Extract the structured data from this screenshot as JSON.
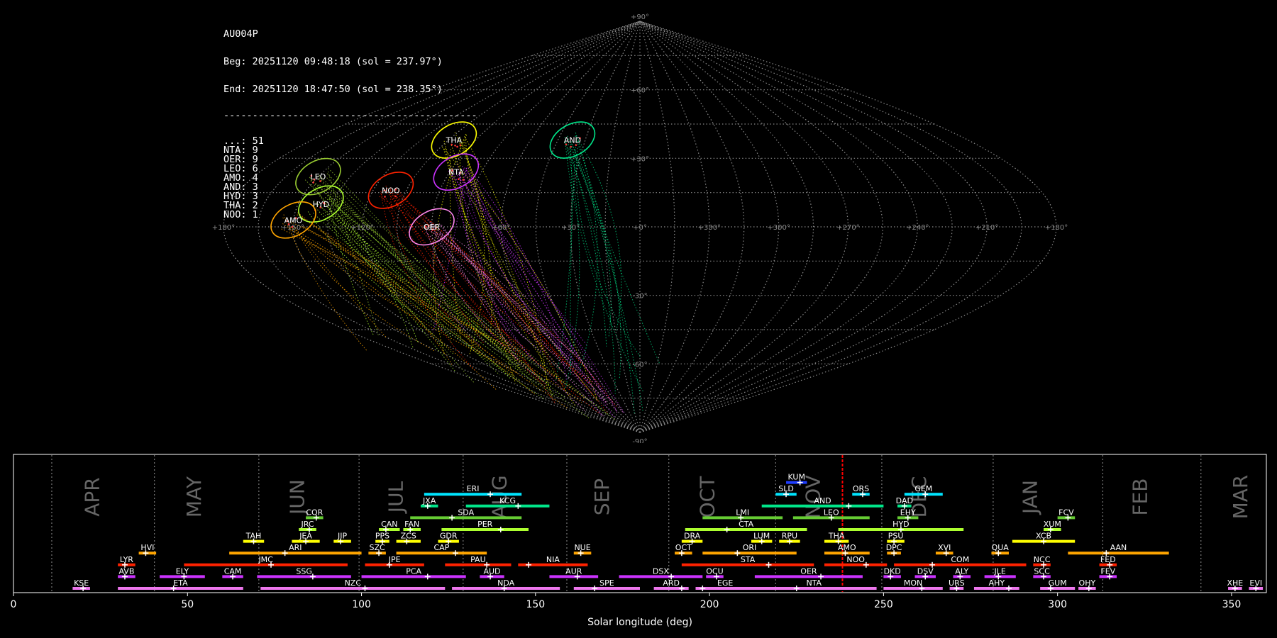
{
  "info": {
    "station": "AU004P",
    "begin": "Beg: 20251120 09:48:18 (sol = 237.97°)",
    "end": "End: 20251120 18:47:50 (sol = 238.35°)",
    "separator": "--------------------------------------------",
    "counts": [
      "...: 51",
      "NTA: 9",
      "OER: 9",
      "LEO: 6",
      "AMO: 4",
      "AND: 3",
      "HYD: 3",
      "THA: 2",
      "NOO: 1"
    ]
  },
  "colors": {
    "background": "#000000",
    "grid": "#888888",
    "current_sol_marker": "#ff0000",
    "timeline_frame": "#ffffff"
  },
  "chart_data": [
    {
      "type": "scatter",
      "projection": "sinusoidal",
      "lon_ticks": [
        "+180°",
        "+150°",
        "+120°",
        "+90°",
        "+60°",
        "+30°",
        "+0°",
        "+330°",
        "+300°",
        "+270°",
        "+240°",
        "+210°",
        "+180°"
      ],
      "lat_ticks": [
        "+90°",
        "+60°",
        "+30°",
        "-30°",
        "-60°",
        "-90°"
      ],
      "radiants": [
        {
          "name": "LEO",
          "lon": 150,
          "lat": 22,
          "color": "#9acd32"
        },
        {
          "name": "THA",
          "lon": 102,
          "lat": 38,
          "color": "#ffff00"
        },
        {
          "name": "AND",
          "lon": 37,
          "lat": 38,
          "color": "#00e68a"
        },
        {
          "name": "NTA",
          "lon": 87,
          "lat": 24,
          "color": "#cc33ff"
        },
        {
          "name": "NOO",
          "lon": 112,
          "lat": 16,
          "color": "#ff2200"
        },
        {
          "name": "HYD",
          "lon": 140,
          "lat": 10,
          "color": "#adff2f"
        },
        {
          "name": "AMO",
          "lon": 150,
          "lat": 3,
          "color": "#ffa500"
        },
        {
          "name": "OER",
          "lon": 90,
          "lat": 0,
          "color": "#ff88ee"
        }
      ]
    },
    {
      "type": "bar",
      "xlabel": "Solar longitude (deg)",
      "xlim": [
        0,
        360
      ],
      "x_ticks": [
        "0",
        "50",
        "100",
        "150",
        "200",
        "250",
        "300",
        "350"
      ],
      "current_sol": 238.2,
      "months": [
        {
          "name": "APR",
          "pos": 24.6
        },
        {
          "name": "MAY",
          "pos": 53.8
        },
        {
          "name": "JUN",
          "pos": 83.5
        },
        {
          "name": "JUL",
          "pos": 111.8
        },
        {
          "name": "AUG",
          "pos": 141.6
        },
        {
          "name": "SEP",
          "pos": 171.0
        },
        {
          "name": "OCT",
          "pos": 201.3
        },
        {
          "name": "NOV",
          "pos": 231.7
        },
        {
          "name": "DEC",
          "pos": 262.2
        },
        {
          "name": "JAN",
          "pos": 294.1
        },
        {
          "name": "FEB",
          "pos": 325.7
        },
        {
          "name": "MAR",
          "pos": 354.5
        }
      ],
      "month_dividers": [
        11.0,
        40.5,
        70.5,
        99.3,
        129.2,
        159.0,
        188.3,
        219.0,
        249.5,
        281.5,
        313.0,
        341.2
      ],
      "showers": [
        {
          "code": "KUM",
          "row": 10,
          "start": 222,
          "end": 228,
          "peak": 226,
          "color": "#1e3cff"
        },
        {
          "code": "ERI",
          "row": 9,
          "start": 118,
          "end": 146,
          "peak": 137,
          "color": "#00e5ff"
        },
        {
          "code": "SLD",
          "row": 9,
          "start": 219,
          "end": 225,
          "peak": 222,
          "color": "#00e5ff"
        },
        {
          "code": "ORS",
          "row": 9,
          "start": 241,
          "end": 246,
          "peak": 244,
          "color": "#00e5ff"
        },
        {
          "code": "GEM",
          "row": 9,
          "start": 256,
          "end": 267,
          "peak": 262,
          "color": "#00e5ff"
        },
        {
          "code": "JXA",
          "row": 8,
          "start": 117,
          "end": 122,
          "peak": 119,
          "color": "#00e68a"
        },
        {
          "code": "KCG",
          "row": 8,
          "start": 130,
          "end": 154,
          "peak": 145,
          "color": "#00e68a"
        },
        {
          "code": "AND",
          "row": 8,
          "start": 215,
          "end": 250,
          "peak": 240,
          "color": "#00e68a"
        },
        {
          "code": "DAD",
          "row": 8,
          "start": 254,
          "end": 258,
          "peak": 256,
          "color": "#00e68a"
        },
        {
          "code": "COR",
          "row": 7,
          "start": 84,
          "end": 89,
          "peak": 87,
          "color": "#66cc33"
        },
        {
          "code": "SDA",
          "row": 7,
          "start": 114,
          "end": 146,
          "peak": 126,
          "color": "#66cc33"
        },
        {
          "code": "LMI",
          "row": 7,
          "start": 198,
          "end": 221,
          "peak": 209,
          "color": "#66cc33"
        },
        {
          "code": "LEO",
          "row": 7,
          "start": 224,
          "end": 246,
          "peak": 235,
          "color": "#66cc33"
        },
        {
          "code": "EHY",
          "row": 7,
          "start": 254,
          "end": 260,
          "peak": 257,
          "color": "#66cc33"
        },
        {
          "code": "FCV",
          "row": 7,
          "start": 300,
          "end": 305,
          "peak": 303,
          "color": "#66cc33"
        },
        {
          "code": "JRC",
          "row": 6,
          "start": 82,
          "end": 87,
          "peak": 85,
          "color": "#adff2f"
        },
        {
          "code": "CAN",
          "row": 6,
          "start": 105,
          "end": 111,
          "peak": 107,
          "color": "#adff2f"
        },
        {
          "code": "FAN",
          "row": 6,
          "start": 112,
          "end": 117,
          "peak": 114,
          "color": "#adff2f"
        },
        {
          "code": "PER",
          "row": 6,
          "start": 123,
          "end": 148,
          "peak": 140,
          "color": "#adff2f"
        },
        {
          "code": "CTA",
          "row": 6,
          "start": 193,
          "end": 228,
          "peak": 205,
          "color": "#adff2f"
        },
        {
          "code": "HYD",
          "row": 6,
          "start": 237,
          "end": 273,
          "peak": 255,
          "color": "#adff2f"
        },
        {
          "code": "XUM",
          "row": 6,
          "start": 296,
          "end": 301,
          "peak": 298,
          "color": "#adff2f"
        },
        {
          "code": "TAH",
          "row": 5,
          "start": 66,
          "end": 72,
          "peak": 69,
          "color": "#ffff00"
        },
        {
          "code": "JEA",
          "row": 5,
          "start": 80,
          "end": 88,
          "peak": 84,
          "color": "#ffff00"
        },
        {
          "code": "JIP",
          "row": 5,
          "start": 92,
          "end": 97,
          "peak": 94,
          "color": "#ffff00"
        },
        {
          "code": "PPS",
          "row": 5,
          "start": 104,
          "end": 108,
          "peak": 106,
          "color": "#ffff00"
        },
        {
          "code": "ZCS",
          "row": 5,
          "start": 110,
          "end": 117,
          "peak": 113,
          "color": "#ffff00"
        },
        {
          "code": "GDR",
          "row": 5,
          "start": 122,
          "end": 128,
          "peak": 125,
          "color": "#ffff00"
        },
        {
          "code": "DRA",
          "row": 5,
          "start": 192,
          "end": 198,
          "peak": 195,
          "color": "#ffff00"
        },
        {
          "code": "LUM",
          "row": 5,
          "start": 212,
          "end": 218,
          "peak": 215,
          "color": "#ffff00"
        },
        {
          "code": "RPU",
          "row": 5,
          "start": 220,
          "end": 226,
          "peak": 223,
          "color": "#ffff00"
        },
        {
          "code": "THA",
          "row": 5,
          "start": 233,
          "end": 240,
          "peak": 237,
          "color": "#ffff00"
        },
        {
          "code": "PSU",
          "row": 5,
          "start": 251,
          "end": 256,
          "peak": 253,
          "color": "#ffff00"
        },
        {
          "code": "XCB",
          "row": 5,
          "start": 287,
          "end": 305,
          "peak": 296,
          "color": "#ffff00"
        },
        {
          "code": "HVI",
          "row": 4,
          "start": 36,
          "end": 41,
          "peak": 38,
          "color": "#ffa500"
        },
        {
          "code": "ARI",
          "row": 4,
          "start": 62,
          "end": 100,
          "peak": 78,
          "color": "#ffa500"
        },
        {
          "code": "SZC",
          "row": 4,
          "start": 102,
          "end": 107,
          "peak": 105,
          "color": "#ffa500"
        },
        {
          "code": "CAP",
          "row": 4,
          "start": 110,
          "end": 136,
          "peak": 127,
          "color": "#ffa500"
        },
        {
          "code": "NUE",
          "row": 4,
          "start": 161,
          "end": 166,
          "peak": 163,
          "color": "#ffa500"
        },
        {
          "code": "OCT",
          "row": 4,
          "start": 190,
          "end": 195,
          "peak": 192,
          "color": "#ffa500"
        },
        {
          "code": "ORI",
          "row": 4,
          "start": 198,
          "end": 225,
          "peak": 208,
          "color": "#ffa500"
        },
        {
          "code": "AMO",
          "row": 4,
          "start": 233,
          "end": 246,
          "peak": 239,
          "color": "#ffa500"
        },
        {
          "code": "DPC",
          "row": 4,
          "start": 251,
          "end": 255,
          "peak": 253,
          "color": "#ffa500"
        },
        {
          "code": "XVI",
          "row": 4,
          "start": 265,
          "end": 270,
          "peak": 268,
          "color": "#ffa500"
        },
        {
          "code": "QUA",
          "row": 4,
          "start": 281,
          "end": 286,
          "peak": 283,
          "color": "#ffa500"
        },
        {
          "code": "AAN",
          "row": 4,
          "start": 303,
          "end": 332,
          "peak": 314,
          "color": "#ffa500"
        },
        {
          "code": "LYR",
          "row": 3,
          "start": 30,
          "end": 35,
          "peak": 32,
          "color": "#ff2200"
        },
        {
          "code": "JMC",
          "row": 3,
          "start": 49,
          "end": 96,
          "peak": 74,
          "color": "#ff2200"
        },
        {
          "code": "JPE",
          "row": 3,
          "start": 101,
          "end": 118,
          "peak": 108,
          "color": "#ff2200"
        },
        {
          "code": "PAU",
          "row": 3,
          "start": 124,
          "end": 143,
          "peak": 136,
          "color": "#ff2200"
        },
        {
          "code": "NIA",
          "row": 3,
          "start": 145,
          "end": 165,
          "peak": 148,
          "color": "#ff2200"
        },
        {
          "code": "STA",
          "row": 3,
          "start": 192,
          "end": 230,
          "peak": 217,
          "color": "#ff2200"
        },
        {
          "code": "NOO",
          "row": 3,
          "start": 233,
          "end": 251,
          "peak": 245,
          "color": "#ff2200"
        },
        {
          "code": "COM",
          "row": 3,
          "start": 253,
          "end": 291,
          "peak": 264,
          "color": "#ff2200"
        },
        {
          "code": "NCC",
          "row": 3,
          "start": 293,
          "end": 298,
          "peak": 296,
          "color": "#ff2200"
        },
        {
          "code": "FED",
          "row": 3,
          "start": 312,
          "end": 317,
          "peak": 315,
          "color": "#ff2200"
        },
        {
          "code": "AVB",
          "row": 2,
          "start": 30,
          "end": 35,
          "peak": 32,
          "color": "#cc33ff"
        },
        {
          "code": "ELY",
          "row": 2,
          "start": 42,
          "end": 55,
          "peak": 49,
          "color": "#cc33ff"
        },
        {
          "code": "CAM",
          "row": 2,
          "start": 60,
          "end": 66,
          "peak": 63,
          "color": "#cc33ff"
        },
        {
          "code": "SSG",
          "row": 2,
          "start": 70,
          "end": 97,
          "peak": 86,
          "color": "#cc33ff"
        },
        {
          "code": "PCA",
          "row": 2,
          "start": 100,
          "end": 130,
          "peak": 119,
          "color": "#cc33ff"
        },
        {
          "code": "AUD",
          "row": 2,
          "start": 134,
          "end": 141,
          "peak": 137,
          "color": "#cc33ff"
        },
        {
          "code": "AUR",
          "row": 2,
          "start": 154,
          "end": 168,
          "peak": 162,
          "color": "#cc33ff"
        },
        {
          "code": "DSX",
          "row": 2,
          "start": 174,
          "end": 198,
          "peak": 189,
          "color": "#cc33ff"
        },
        {
          "code": "OCU",
          "row": 2,
          "start": 199,
          "end": 204,
          "peak": 202,
          "color": "#cc33ff"
        },
        {
          "code": "OER",
          "row": 2,
          "start": 213,
          "end": 244,
          "peak": 232,
          "color": "#cc33ff"
        },
        {
          "code": "DKD",
          "row": 2,
          "start": 250,
          "end": 255,
          "peak": 252,
          "color": "#cc33ff"
        },
        {
          "code": "DSV",
          "row": 2,
          "start": 259,
          "end": 265,
          "peak": 262,
          "color": "#cc33ff"
        },
        {
          "code": "ALY",
          "row": 2,
          "start": 270,
          "end": 275,
          "peak": 272,
          "color": "#cc33ff"
        },
        {
          "code": "JLE",
          "row": 2,
          "start": 279,
          "end": 288,
          "peak": 283,
          "color": "#cc33ff"
        },
        {
          "code": "SCC",
          "row": 2,
          "start": 293,
          "end": 298,
          "peak": 296,
          "color": "#cc33ff"
        },
        {
          "code": "FEV",
          "row": 2,
          "start": 312,
          "end": 317,
          "peak": 315,
          "color": "#cc33ff"
        },
        {
          "code": "KSE",
          "row": 1,
          "start": 17,
          "end": 22,
          "peak": 20,
          "color": "#ee77ee"
        },
        {
          "code": "ETA",
          "row": 1,
          "start": 30,
          "end": 66,
          "peak": 46,
          "color": "#ee77ee"
        },
        {
          "code": "NZC",
          "row": 1,
          "start": 71,
          "end": 124,
          "peak": 101,
          "color": "#ee77ee"
        },
        {
          "code": "NDA",
          "row": 1,
          "start": 126,
          "end": 157,
          "peak": 141,
          "color": "#ee77ee"
        },
        {
          "code": "SPE",
          "row": 1,
          "start": 161,
          "end": 180,
          "peak": 167,
          "color": "#ee77ee"
        },
        {
          "code": "ARD",
          "row": 1,
          "start": 184,
          "end": 194,
          "peak": 192,
          "color": "#ee77ee"
        },
        {
          "code": "EGE",
          "row": 1,
          "start": 196,
          "end": 213,
          "peak": 198,
          "color": "#ee77ee"
        },
        {
          "code": "NTA",
          "row": 1,
          "start": 212,
          "end": 248,
          "peak": 225,
          "color": "#ee77ee"
        },
        {
          "code": "MON",
          "row": 1,
          "start": 250,
          "end": 267,
          "peak": 261,
          "color": "#ee77ee"
        },
        {
          "code": "URS",
          "row": 1,
          "start": 269,
          "end": 273,
          "peak": 271,
          "color": "#ee77ee"
        },
        {
          "code": "AHY",
          "row": 1,
          "start": 276,
          "end": 289,
          "peak": 286,
          "color": "#ee77ee"
        },
        {
          "code": "GUM",
          "row": 1,
          "start": 295,
          "end": 305,
          "peak": 298,
          "color": "#ee77ee"
        },
        {
          "code": "OHY",
          "row": 1,
          "start": 306,
          "end": 311,
          "peak": 309,
          "color": "#ee77ee"
        },
        {
          "code": "XHE",
          "row": 1,
          "start": 349,
          "end": 353,
          "peak": 351,
          "color": "#ee77ee"
        },
        {
          "code": "EVI",
          "row": 1,
          "start": 355,
          "end": 359,
          "peak": 357,
          "color": "#ee77ee"
        }
      ]
    }
  ]
}
